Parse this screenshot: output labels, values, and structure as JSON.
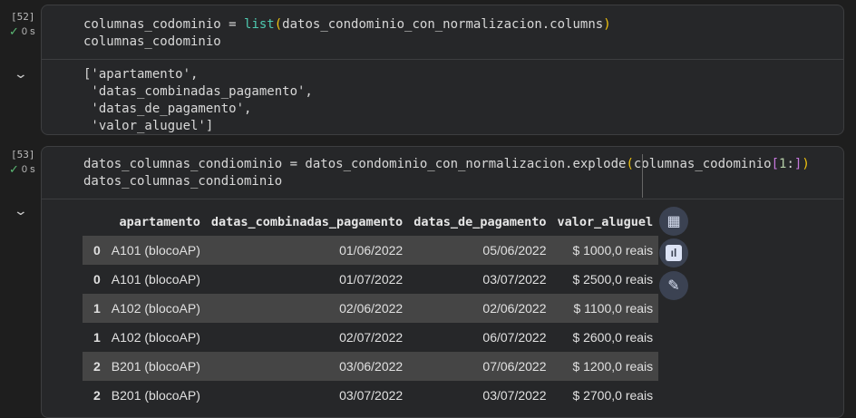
{
  "cells": [
    {
      "number": "[52]",
      "status": "0 s",
      "code": [
        "columnas_codominio = ",
        "list",
        "(",
        "datos_condominio_con_normalizacion.columns",
        ")",
        "columnas_codominio"
      ],
      "output": [
        "['apartamento',",
        " 'datas_combinadas_pagamento',",
        " 'datas_de_pagamento',",
        " 'valor_aluguel']"
      ]
    },
    {
      "number": "[53]",
      "status": "0 s",
      "code": [
        "datos_columnas_condiominio = datos_condominio_con_normalizacion.explode",
        "(",
        "columnas_codominio",
        "[",
        "1",
        ":",
        "]",
        ")",
        "datos_columnas_condiominio"
      ],
      "table": {
        "columns": [
          "",
          "apartamento",
          "datas_combinadas_pagamento",
          "datas_de_pagamento",
          "valor_aluguel"
        ],
        "rows": [
          [
            "0",
            "A101 (blocoAP)",
            "01/06/2022",
            "05/06/2022",
            "$ 1000,0 reais"
          ],
          [
            "0",
            "A101 (blocoAP)",
            "01/07/2022",
            "03/07/2022",
            "$ 2500,0 reais"
          ],
          [
            "1",
            "A102 (blocoAP)",
            "02/06/2022",
            "02/06/2022",
            "$ 1100,0 reais"
          ],
          [
            "1",
            "A102 (blocoAP)",
            "02/07/2022",
            "06/07/2022",
            "$ 2600,0 reais"
          ],
          [
            "2",
            "B201 (blocoAP)",
            "03/06/2022",
            "07/06/2022",
            "$ 1200,0 reais"
          ],
          [
            "2",
            "B201 (blocoAP)",
            "03/07/2022",
            "03/07/2022",
            "$ 2700,0 reais"
          ]
        ]
      },
      "table_actions": [
        "table-icon",
        "chart-icon",
        "magic-edit-icon"
      ]
    }
  ]
}
